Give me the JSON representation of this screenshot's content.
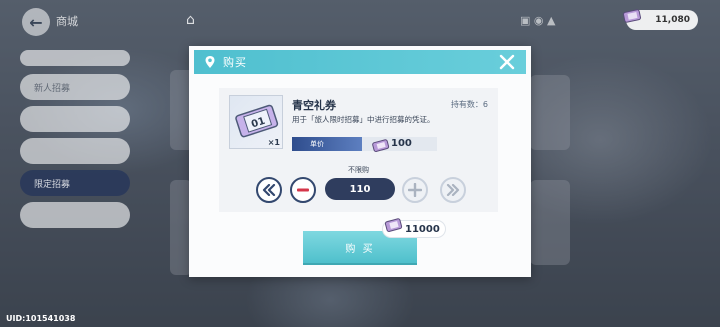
{
  "topbar": {
    "title": "商城",
    "currency_value": "11,080"
  },
  "left_menu": {
    "items": [
      "",
      "新人招募",
      "",
      "",
      "限定招募",
      ""
    ],
    "active_index": 4
  },
  "uid": "UID:101541038",
  "dialog": {
    "title": "购买",
    "item": {
      "name": "青空礼券",
      "owned_label": "持有数：6",
      "description": "用于「旅人限时招募」中进行招募的凭证。",
      "thumb_qty": "×1",
      "thumb_number": "01",
      "price_label": "单价",
      "price_value": "100"
    },
    "limit_text": "不限购",
    "quantity": "110",
    "total_cost": "11000",
    "buy_label": "购 买"
  },
  "colors": {
    "header": "#4fbfcf",
    "dark_navy": "#2f3d5e",
    "buy_button": "#5ec8d3"
  },
  "icons": [
    "back-arrow-icon",
    "home-icon",
    "ticket-icon",
    "pin-icon",
    "close-icon",
    "double-chevron-left-icon",
    "minus-icon",
    "plus-icon",
    "double-chevron-right-icon"
  ]
}
